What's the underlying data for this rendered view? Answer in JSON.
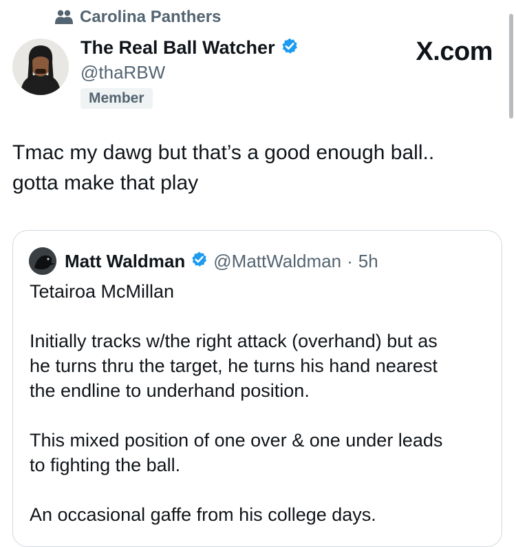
{
  "community": {
    "icon": "community-people-icon",
    "name": "Carolina Panthers"
  },
  "author": {
    "display_name": "The Real Ball Watcher",
    "handle": "@thaRBW",
    "badge": "Member",
    "verified_icon": "verified-badge-icon",
    "avatar_icon": "user-avatar-photo"
  },
  "brand": {
    "text": "X.com"
  },
  "tweet": {
    "lines": [
      "Tmac my dawg but that’s a good enough ball..",
      "gotta make that play"
    ]
  },
  "quote": {
    "avatar_icon": "raven-avatar-icon",
    "display_name": "Matt Waldman",
    "verified_icon": "verified-badge-icon",
    "handle": "@MattWaldman",
    "separator": "·",
    "time": "5h",
    "paragraphs": [
      [
        "Tetairoa McMillan"
      ],
      [
        "Initially tracks w/the right attack (overhand) but as",
        "he turns thru the target, he turns his hand nearest",
        "the endline to underhand position."
      ],
      [
        "This mixed position of one over & one under leads",
        "to fighting the ball."
      ],
      [
        "An occasional gaffe from his college days."
      ]
    ]
  },
  "colors": {
    "verified": "#1d9bf0",
    "secondary_text": "#536471",
    "border": "#cfd9de",
    "badge_bg": "#eff3f4"
  }
}
